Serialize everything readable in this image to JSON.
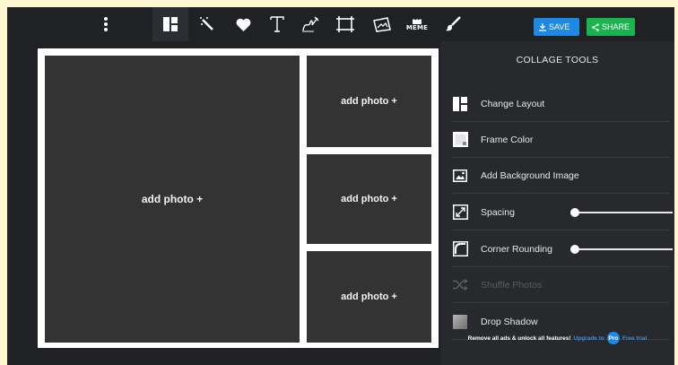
{
  "toolbar": {
    "icons": [
      "more-vertical-icon",
      "layout-icon",
      "magic-wand-icon",
      "heart-icon",
      "text-icon",
      "doodle-icon",
      "crop-icon",
      "image-frame-icon",
      "meme-icon",
      "paint-brush-icon"
    ],
    "meme_label": "MEME",
    "save_label": "SAVE",
    "share_label": "SHARE",
    "colors": {
      "save": "#1e88e5",
      "share": "#1bb34f"
    }
  },
  "collage": {
    "cells": [
      {
        "label": "add photo +"
      },
      {
        "label": "add photo +"
      },
      {
        "label": "add photo +"
      },
      {
        "label": "add photo +"
      }
    ]
  },
  "panel": {
    "title": "COLLAGE TOOLS",
    "tools": [
      {
        "label": "Change Layout",
        "icon": "layout-icon"
      },
      {
        "label": "Frame Color",
        "icon": "frame-color-icon"
      },
      {
        "label": "Add Background Image",
        "icon": "image-icon"
      },
      {
        "label": "Spacing",
        "icon": "spacing-icon",
        "slider_value": 0
      },
      {
        "label": "Corner Rounding",
        "icon": "corner-rounding-icon",
        "slider_value": 0
      },
      {
        "label": "Shuffle Photos",
        "icon": "shuffle-icon",
        "disabled": true
      },
      {
        "label": "Drop Shadow",
        "icon": "drop-shadow-icon"
      }
    ],
    "promo": {
      "text": "Remove all ads & unlock all features!",
      "link": "Upgrade to",
      "badge": "Pro",
      "trial": "Free trial"
    }
  }
}
